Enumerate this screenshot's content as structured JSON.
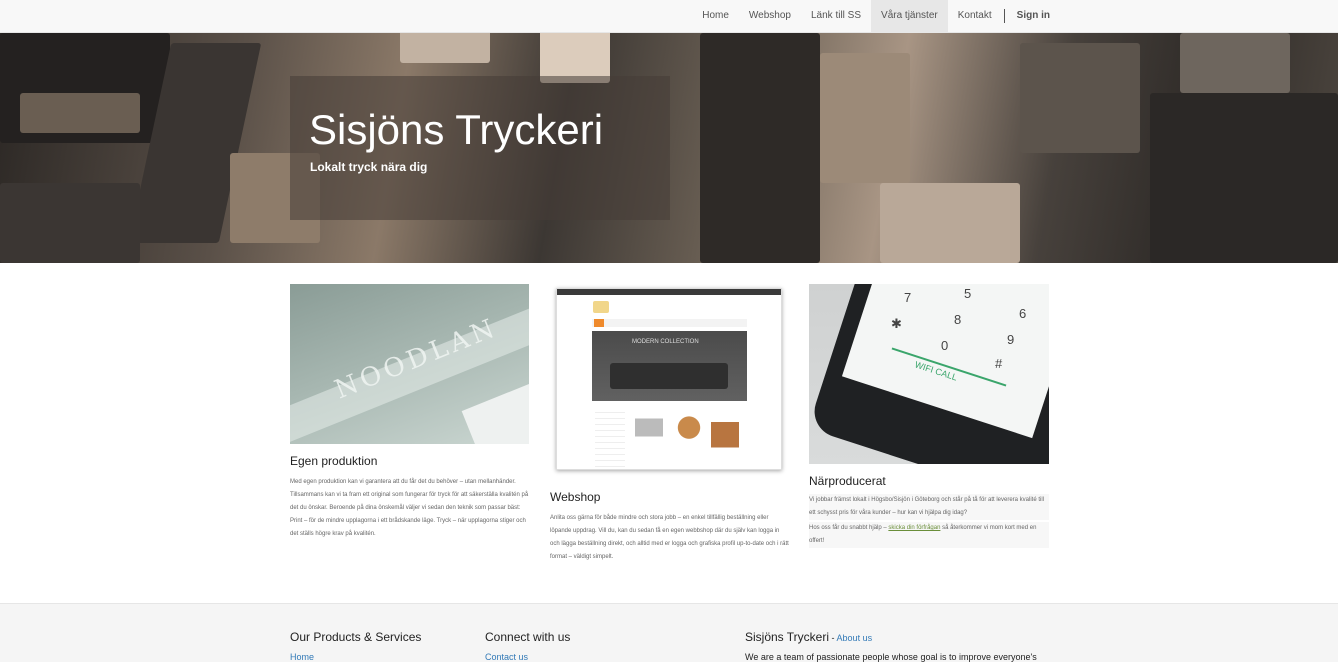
{
  "nav": {
    "items": [
      "Home",
      "Webshop",
      "Länk till SS",
      "Våra tjänster",
      "Kontakt"
    ],
    "signin": "Sign in"
  },
  "hero": {
    "title": "Sisjöns Tryckeri",
    "subtitle": "Lokalt tryck nära dig"
  },
  "columns": {
    "egen": {
      "title": "Egen produktion",
      "text": "Med egen produktion kan vi garantera att du får det du behöver – utan mellanhänder. Tillsammans kan vi ta fram ett original som fungerar för tryck för att säkerställa kvalitén på det du önskar. Beroende på dina önskemål väljer vi sedan den teknik som passar bäst: Print – för de mindre upplagorna i ett brådskande läge. Tryck – när upplagorna stiger och det ställs högre krav på kvalitén."
    },
    "webshop": {
      "title": "Webshop",
      "text": "Anlita oss gärna för både mindre och stora jobb – en enkel tillfällig beställning eller löpande uppdrag. Vill du, kan du sedan få en egen webbshop där du själv kan logga in och lägga beställning direkt, och alltid med er logga och grafiska profil up-to-date och i rätt format – väldigt simpelt.",
      "screenshot_title": "MODERN COLLECTION"
    },
    "nara": {
      "title": "Närproducerat",
      "text1": "Vi jobbar främst lokalt i Högsbo/Sisjön i Göteborg och står på tå för att leverera kvalité till ett schysst pris för våra kunder – hur kan vi hjälpa dig idag?",
      "text2_pre": "Hos oss får du snabbt hjälp – ",
      "text2_link": "skicka din förfrågan",
      "text2_post": " så återkommer vi mom kort med en offert!",
      "wifi": "WIFI CALL"
    }
  },
  "footer": {
    "col1_title": "Our Products & Services",
    "col1_link": "Home",
    "col2_title": "Connect with us",
    "col2_link": "Contact us",
    "col3_title": "Sisjöns Tryckeri",
    "col3_dash": " - ",
    "col3_link": "About us",
    "col3_text": "We are a team of passionate people whose goal is to improve everyone's"
  },
  "colors": {
    "nav_bg": "#f8f8f8",
    "active_bg": "#e7e7e7",
    "link": "#337ab7",
    "green_link": "#6a8e3a",
    "footer_bg": "#f5f5f5"
  },
  "icons": [
    "phone-image",
    "webshop-screenshot",
    "print-sample-image"
  ]
}
